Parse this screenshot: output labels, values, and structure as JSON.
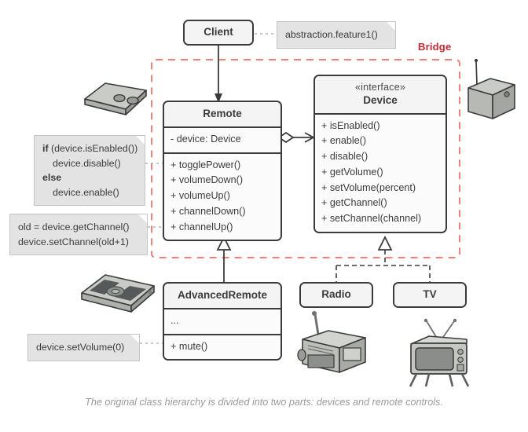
{
  "diagram": {
    "pattern_label": "Bridge",
    "pattern_label_color": "#cf2532",
    "region_border_color": "#ef8273",
    "caption": "The original class hierarchy is divided into two parts: devices and remote controls."
  },
  "classes": {
    "client": {
      "name": "Client"
    },
    "remote": {
      "name": "Remote",
      "fields": [
        "- device: Device"
      ],
      "methods": [
        "+ togglePower()",
        "+ volumeDown()",
        "+ volumeUp()",
        "+ channelDown()",
        "+ channelUp()"
      ]
    },
    "device": {
      "stereotype": "«interface»",
      "name": "Device",
      "methods": [
        "+ isEnabled()",
        "+ enable()",
        "+ disable()",
        "+ getVolume()",
        "+ setVolume(percent)",
        "+ getChannel()",
        "+ setChannel(channel)"
      ]
    },
    "advanced_remote": {
      "name": "AdvancedRemote",
      "fields": [
        "..."
      ],
      "methods": [
        "+ mute()"
      ]
    },
    "radio": {
      "name": "Radio"
    },
    "tv": {
      "name": "TV"
    }
  },
  "notes": {
    "client_note": {
      "lines": [
        "abstraction.feature1()"
      ]
    },
    "toggle_power_note": {
      "lines": [
        {
          "kw": "if",
          "rest": " (device.isEnabled())"
        },
        {
          "indent": true,
          "rest": "device.disable()"
        },
        {
          "kw": "else",
          "rest": ""
        },
        {
          "indent": true,
          "rest": "device.enable()"
        }
      ]
    },
    "channel_up_note": {
      "lines": [
        "old = device.getChannel()",
        "device.setChannel(old+1)"
      ]
    },
    "mute_note": {
      "lines": [
        "device.setVolume(0)"
      ]
    }
  },
  "illustrations": {
    "simple_remote": "simple-remote-illustration",
    "advanced_remote": "advanced-remote-illustration",
    "radio": "radio-illustration",
    "tv": "tv-illustration"
  }
}
